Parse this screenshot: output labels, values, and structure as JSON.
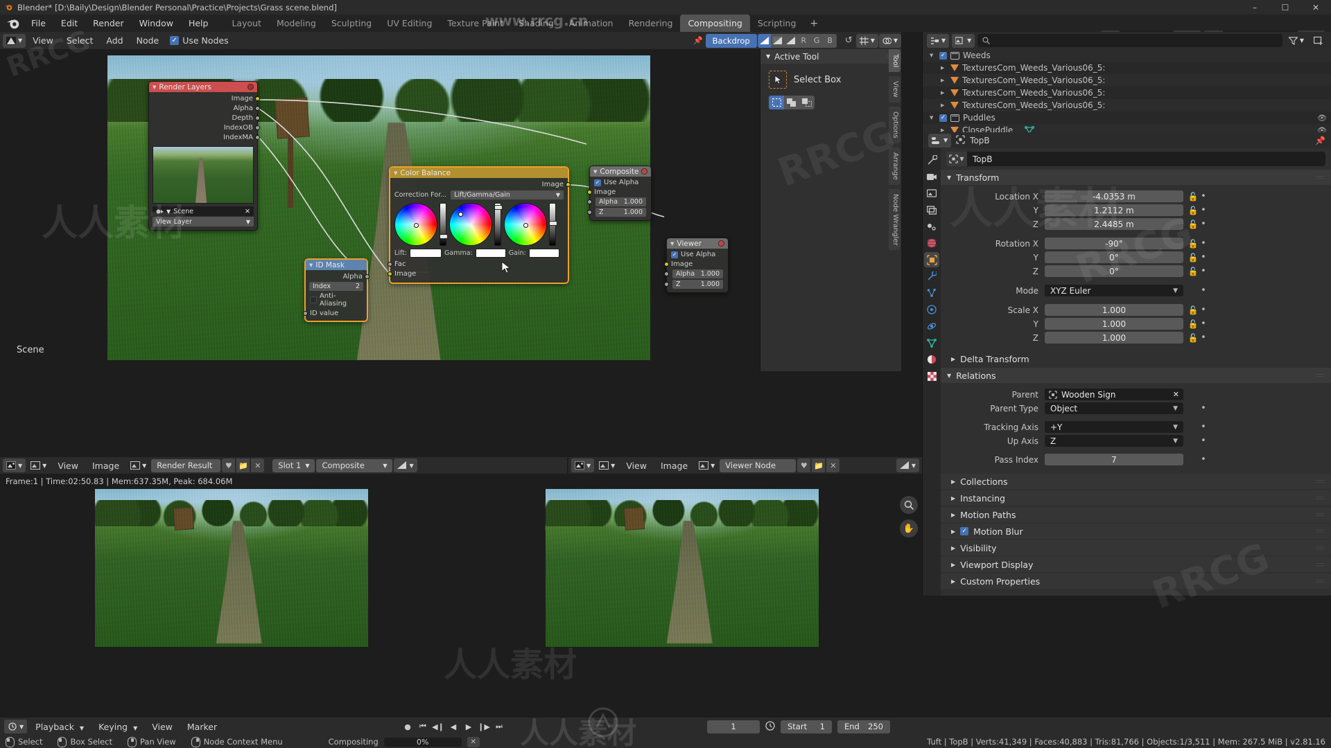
{
  "window": {
    "title": "Blender* [D:\\Baily\\Design\\Blender Personal\\Practice\\Projects\\Grass scene.blend]",
    "minimize": "–",
    "maximize": "☐",
    "close": "✕"
  },
  "menubar": {
    "items": [
      "File",
      "Edit",
      "Render",
      "Window",
      "Help"
    ],
    "workspaces": [
      {
        "label": "Layout",
        "active": false
      },
      {
        "label": "Modeling",
        "active": false
      },
      {
        "label": "Sculpting",
        "active": false
      },
      {
        "label": "UV Editing",
        "active": false
      },
      {
        "label": "Texture Paint",
        "active": false
      },
      {
        "label": "Shading",
        "active": false
      },
      {
        "label": "Animation",
        "active": false
      },
      {
        "label": "Rendering",
        "active": false
      },
      {
        "label": "Compositing",
        "active": true
      },
      {
        "label": "Scripting",
        "active": false
      }
    ],
    "add_workspace": "+",
    "scene_name": "Scene",
    "view_layer_name": "View Layer"
  },
  "node_header": {
    "editor_type": "compositor-icon",
    "menus": [
      "View",
      "Select",
      "Add",
      "Node"
    ],
    "use_nodes_label": "Use Nodes",
    "use_nodes_checked": true,
    "backdrop_label": "Backdrop",
    "channel_buttons": [
      "R",
      "G",
      "B"
    ],
    "pin_icon": "pin-icon",
    "snap_icon": "snap-icon"
  },
  "nodes": [
    {
      "name": "Render Layers",
      "header_color": "#cc4e4e",
      "selected": false,
      "outputs": [
        "Image",
        "Alpha",
        "Depth",
        "IndexOB",
        "IndexMA"
      ],
      "scene_field": "Scene",
      "layer_field": "View Layer"
    },
    {
      "name": "Composite",
      "header_color": "#6c6c6c",
      "selected": false,
      "use_alpha_label": "Use Alpha",
      "use_alpha_checked": true,
      "inputs": [
        {
          "label": "Image",
          "value": ""
        },
        {
          "label": "Alpha",
          "value": "1.000"
        },
        {
          "label": "Z",
          "value": "1.000"
        }
      ]
    },
    {
      "name": "Viewer",
      "header_color": "#6c6c6c",
      "selected": false,
      "use_alpha_label": "Use Alpha",
      "use_alpha_checked": true,
      "inputs": [
        {
          "label": "Image",
          "value": ""
        },
        {
          "label": "Alpha",
          "value": "1.000"
        },
        {
          "label": "Z",
          "value": "1.000"
        }
      ]
    },
    {
      "name": "Color Balance",
      "header_color": "#b3902f",
      "selected": true,
      "output_label": "Image",
      "correction_label": "Correction For...",
      "correction_value": "Lift/Gamma/Gain",
      "wheels": [
        {
          "label": "Lift:",
          "value": ""
        },
        {
          "label": "Gamma:",
          "value": ""
        },
        {
          "label": "Gain:",
          "value": ""
        }
      ],
      "fac_label": "Fac",
      "image_label": "Image"
    },
    {
      "name": "ID Mask",
      "header_color": "#5d83ae",
      "selected": true,
      "output_label": "Alpha",
      "index_label": "Index",
      "index_value": "2",
      "antialias_label": "Anti-Aliasing",
      "antialias_checked": false,
      "input_label": "ID value"
    }
  ],
  "node_sidebar": {
    "panel_title": "Active Tool",
    "tool_name": "Select Box",
    "tabs": [
      "Tool",
      "View",
      "Options",
      "Arrange",
      "Node Wrangler"
    ],
    "active_tab": "Tool",
    "scene_overlay_label": "Scene"
  },
  "outliner": {
    "filter_placeholder": "",
    "rows": [
      {
        "label": "Weeds",
        "indent": 0,
        "type": "collection",
        "checkbox": true,
        "expanded": true,
        "eye": false
      },
      {
        "label": "TexturesCom_Weeds_Various06_5:",
        "indent": 1,
        "type": "mesh",
        "checkbox": false,
        "expanded": false,
        "eye": false
      },
      {
        "label": "TexturesCom_Weeds_Various06_5:",
        "indent": 1,
        "type": "mesh",
        "checkbox": false,
        "expanded": false,
        "eye": false
      },
      {
        "label": "TexturesCom_Weeds_Various06_5:",
        "indent": 1,
        "type": "mesh",
        "checkbox": false,
        "expanded": false,
        "eye": false
      },
      {
        "label": "TexturesCom_Weeds_Various06_5:",
        "indent": 1,
        "type": "mesh",
        "checkbox": false,
        "expanded": false,
        "eye": false
      },
      {
        "label": "Puddles",
        "indent": 0,
        "type": "collection",
        "checkbox": true,
        "expanded": true,
        "eye": true
      },
      {
        "label": "ClosePuddle",
        "indent": 1,
        "type": "mesh",
        "checkbox": false,
        "expanded": false,
        "eye": true
      }
    ]
  },
  "properties": {
    "breadcrumb_object": "TopB",
    "object_name": "TopB",
    "transform": {
      "title": "Transform",
      "location_labels": [
        "Location X",
        "Y",
        "Z"
      ],
      "location_values": [
        "-4.0353 m",
        "1.2112 m",
        "2.4485 m"
      ],
      "rotation_labels": [
        "Rotation X",
        "Y",
        "Z"
      ],
      "rotation_values": [
        "-90°",
        "0°",
        "0°"
      ],
      "mode_label": "Mode",
      "mode_value": "XYZ Euler",
      "scale_labels": [
        "Scale X",
        "Y",
        "Z"
      ],
      "scale_values": [
        "1.000",
        "1.000",
        "1.000"
      ],
      "delta_label": "Delta Transform"
    },
    "relations": {
      "title": "Relations",
      "parent_label": "Parent",
      "parent_value": "Wooden Sign",
      "parent_clear": "✕",
      "parent_type_label": "Parent Type",
      "parent_type_value": "Object",
      "tracking_axis_label": "Tracking Axis",
      "tracking_axis_value": "+Y",
      "up_axis_label": "Up Axis",
      "up_axis_value": "Z",
      "pass_index_label": "Pass Index",
      "pass_index_value": "7"
    },
    "closed_sections": [
      "Collections",
      "Instancing",
      "Motion Paths",
      "Motion Blur",
      "Visibility",
      "Viewport Display",
      "Custom Properties"
    ],
    "motion_blur_checked": true
  },
  "image_editor_left": {
    "menus": [
      "View",
      "Image"
    ],
    "image_name": "Render Result",
    "slot_label": "Slot 1",
    "pass_label": "Composite",
    "info_line": "Frame:1 | Time:02:50.83 | Mem:637.35M, Peak: 684.06M"
  },
  "image_editor_right": {
    "menus": [
      "View",
      "Image"
    ],
    "image_name": "Viewer Node"
  },
  "timeline": {
    "menus": [
      "Playback",
      "Keying",
      "View",
      "Marker"
    ],
    "current_frame": "1",
    "start_label": "Start",
    "start_value": "1",
    "end_label": "End",
    "end_value": "250"
  },
  "statusbar": {
    "shortcuts": [
      {
        "icon": "mouse-left",
        "label": "Select"
      },
      {
        "icon": "mouse-left-drag",
        "label": "Box Select"
      },
      {
        "icon": "mouse-middle",
        "label": "Pan View"
      },
      {
        "icon": "mouse-right",
        "label": "Node Context Menu"
      }
    ],
    "job_label": "Compositing",
    "job_progress": "0%",
    "job_cancel": "✕",
    "stats": "Tuft | TopB | Verts:41,349 | Faces:40,883 | Tris:81,766 | Objects:1/3,511 | Mem: 267.5 MiB | v2.81.16"
  },
  "watermarks": [
    "www.rrcg.cn",
    "RRCG",
    "人人素材"
  ]
}
